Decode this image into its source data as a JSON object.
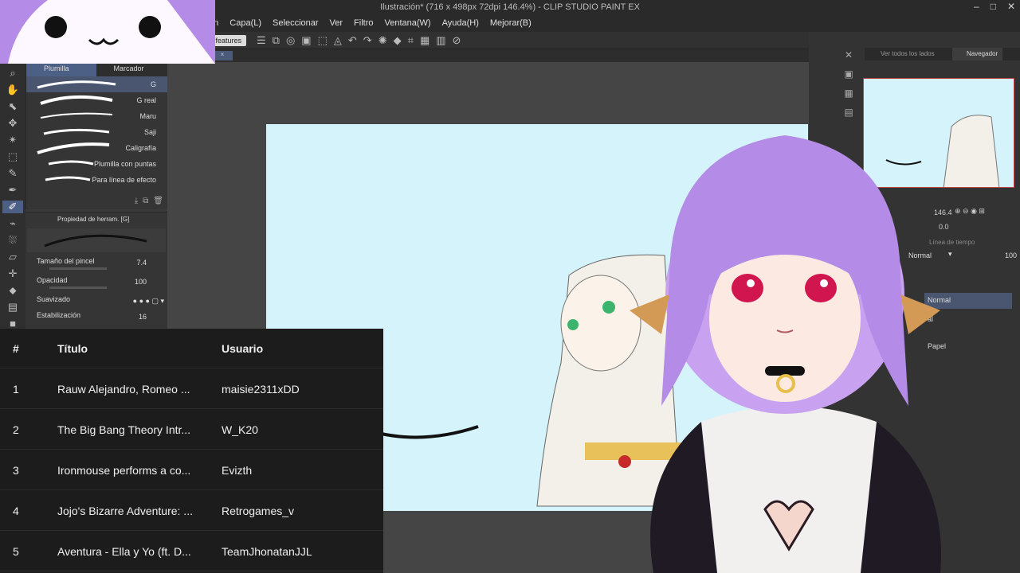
{
  "window": {
    "title": "Ilustración* (716 x 498px 72dpi 146.4%) - CLIP STUDIO PAINT EX"
  },
  "menu": [
    "ación",
    "Capa(L)",
    "Seleccionar",
    "Ver",
    "Filtro",
    "Ventana(W)",
    "Ayuda(H)",
    "Mejorar(B)"
  ],
  "toolbar": {
    "features_label": "ble features"
  },
  "subtool": {
    "tabs": [
      "Plumilla",
      "Marcador"
    ],
    "brushes": [
      {
        "name": "G",
        "selected": true
      },
      {
        "name": "G real",
        "selected": false
      },
      {
        "name": "Maru",
        "selected": false
      },
      {
        "name": "Saji",
        "selected": false
      },
      {
        "name": "Caligrafía",
        "selected": false
      },
      {
        "name": "Plumilla con puntas",
        "selected": false
      },
      {
        "name": "Para línea de efecto",
        "selected": false
      }
    ]
  },
  "tool_property": {
    "header": "Propiedad de herram. [G]",
    "props": [
      {
        "label": "Tamaño del pincel",
        "value": "7.4"
      },
      {
        "label": "Opacidad",
        "value": "100"
      },
      {
        "label": "Suavizado",
        "value": ""
      },
      {
        "label": "Estabilización",
        "value": "16"
      }
    ]
  },
  "navigator": {
    "tab_all": "Ver todos los lados",
    "tab_nav": "Navegador",
    "zoom": "146.4",
    "rotation": "0.0"
  },
  "layers": {
    "timeline_tab": "Línea de tiempo",
    "blend_mode": "Normal",
    "opacity": "100",
    "rows": [
      {
        "name": "Normal",
        "selected": true
      },
      {
        "name": "al",
        "selected": false
      },
      {
        "name": "Papel",
        "selected": false
      }
    ]
  },
  "recent_table": {
    "headers": [
      "#",
      "Título",
      "Usuario"
    ],
    "rows": [
      {
        "num": "1",
        "title": "Rauw Alejandro, Romeo ...",
        "user": "maisie2311xDD"
      },
      {
        "num": "2",
        "title": "The Big Bang Theory Intr...",
        "user": "W_K20"
      },
      {
        "num": "3",
        "title": "Ironmouse performs a co...",
        "user": "Evizth"
      },
      {
        "num": "4",
        "title": "Jojo's Bizarre Adventure: ...",
        "user": "Retrogames_v"
      },
      {
        "num": "5",
        "title": "Aventura - Ella y Yo (ft. D...",
        "user": "TeamJhonatanJJL"
      }
    ]
  },
  "colors": {
    "accent": "#4c5f85",
    "canvas": "#d4f3fb",
    "hair": "#b48be6"
  }
}
